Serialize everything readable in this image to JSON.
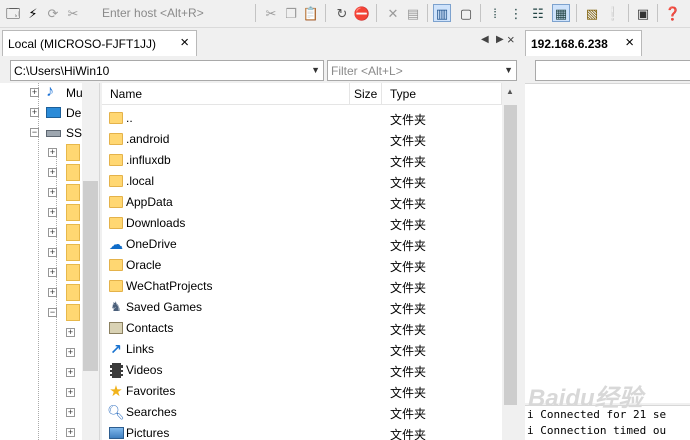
{
  "toolbar": {
    "host_placeholder": "Enter host <Alt+R>"
  },
  "local": {
    "tab_label": "Local (MICROSO-FJFT1JJ)",
    "tab_close": "×",
    "tab_prev": "◀",
    "tab_next": "▶",
    "tab_close_all": "×",
    "path": "C:\\Users\\HiWin10",
    "filter_placeholder": "Filter <Alt+L>",
    "tree": [
      {
        "label": "Mu"
      },
      {
        "label": "De"
      },
      {
        "label": "SS"
      },
      {
        "label": ""
      },
      {
        "label": ""
      },
      {
        "label": ""
      },
      {
        "label": ""
      },
      {
        "label": ""
      },
      {
        "label": ""
      },
      {
        "label": ""
      },
      {
        "label": ""
      },
      {
        "label": ""
      },
      {
        "label": ""
      },
      {
        "label": ""
      },
      {
        "label": ""
      },
      {
        "label": ""
      },
      {
        "label": ""
      },
      {
        "label": ""
      }
    ],
    "columns": {
      "name": "Name",
      "size": "Size",
      "type": "Type"
    },
    "files": [
      {
        "name": "..",
        "type": "文件夹",
        "icon": "folder"
      },
      {
        "name": ".android",
        "type": "文件夹",
        "icon": "folder"
      },
      {
        "name": ".influxdb",
        "type": "文件夹",
        "icon": "folder"
      },
      {
        "name": ".local",
        "type": "文件夹",
        "icon": "folder"
      },
      {
        "name": "AppData",
        "type": "文件夹",
        "icon": "folder"
      },
      {
        "name": "Downloads",
        "type": "文件夹",
        "icon": "folder"
      },
      {
        "name": "OneDrive",
        "type": "文件夹",
        "icon": "cloud"
      },
      {
        "name": "Oracle",
        "type": "文件夹",
        "icon": "folder"
      },
      {
        "name": "WeChatProjects",
        "type": "文件夹",
        "icon": "folder"
      },
      {
        "name": "Saved Games",
        "type": "文件夹",
        "icon": "gamepad"
      },
      {
        "name": "Contacts",
        "type": "文件夹",
        "icon": "contacts"
      },
      {
        "name": "Links",
        "type": "文件夹",
        "icon": "link"
      },
      {
        "name": "Videos",
        "type": "文件夹",
        "icon": "film"
      },
      {
        "name": "Favorites",
        "type": "文件夹",
        "icon": "star"
      },
      {
        "name": "Searches",
        "type": "文件夹",
        "icon": "search"
      },
      {
        "name": "Pictures",
        "type": "文件夹",
        "icon": "picture"
      }
    ]
  },
  "remote": {
    "tab_label": "192.168.6.238",
    "tab_close": "×",
    "log": [
      "i Connected for 21 se",
      "i Connection timed ou"
    ]
  },
  "watermark": "Baidu经验"
}
